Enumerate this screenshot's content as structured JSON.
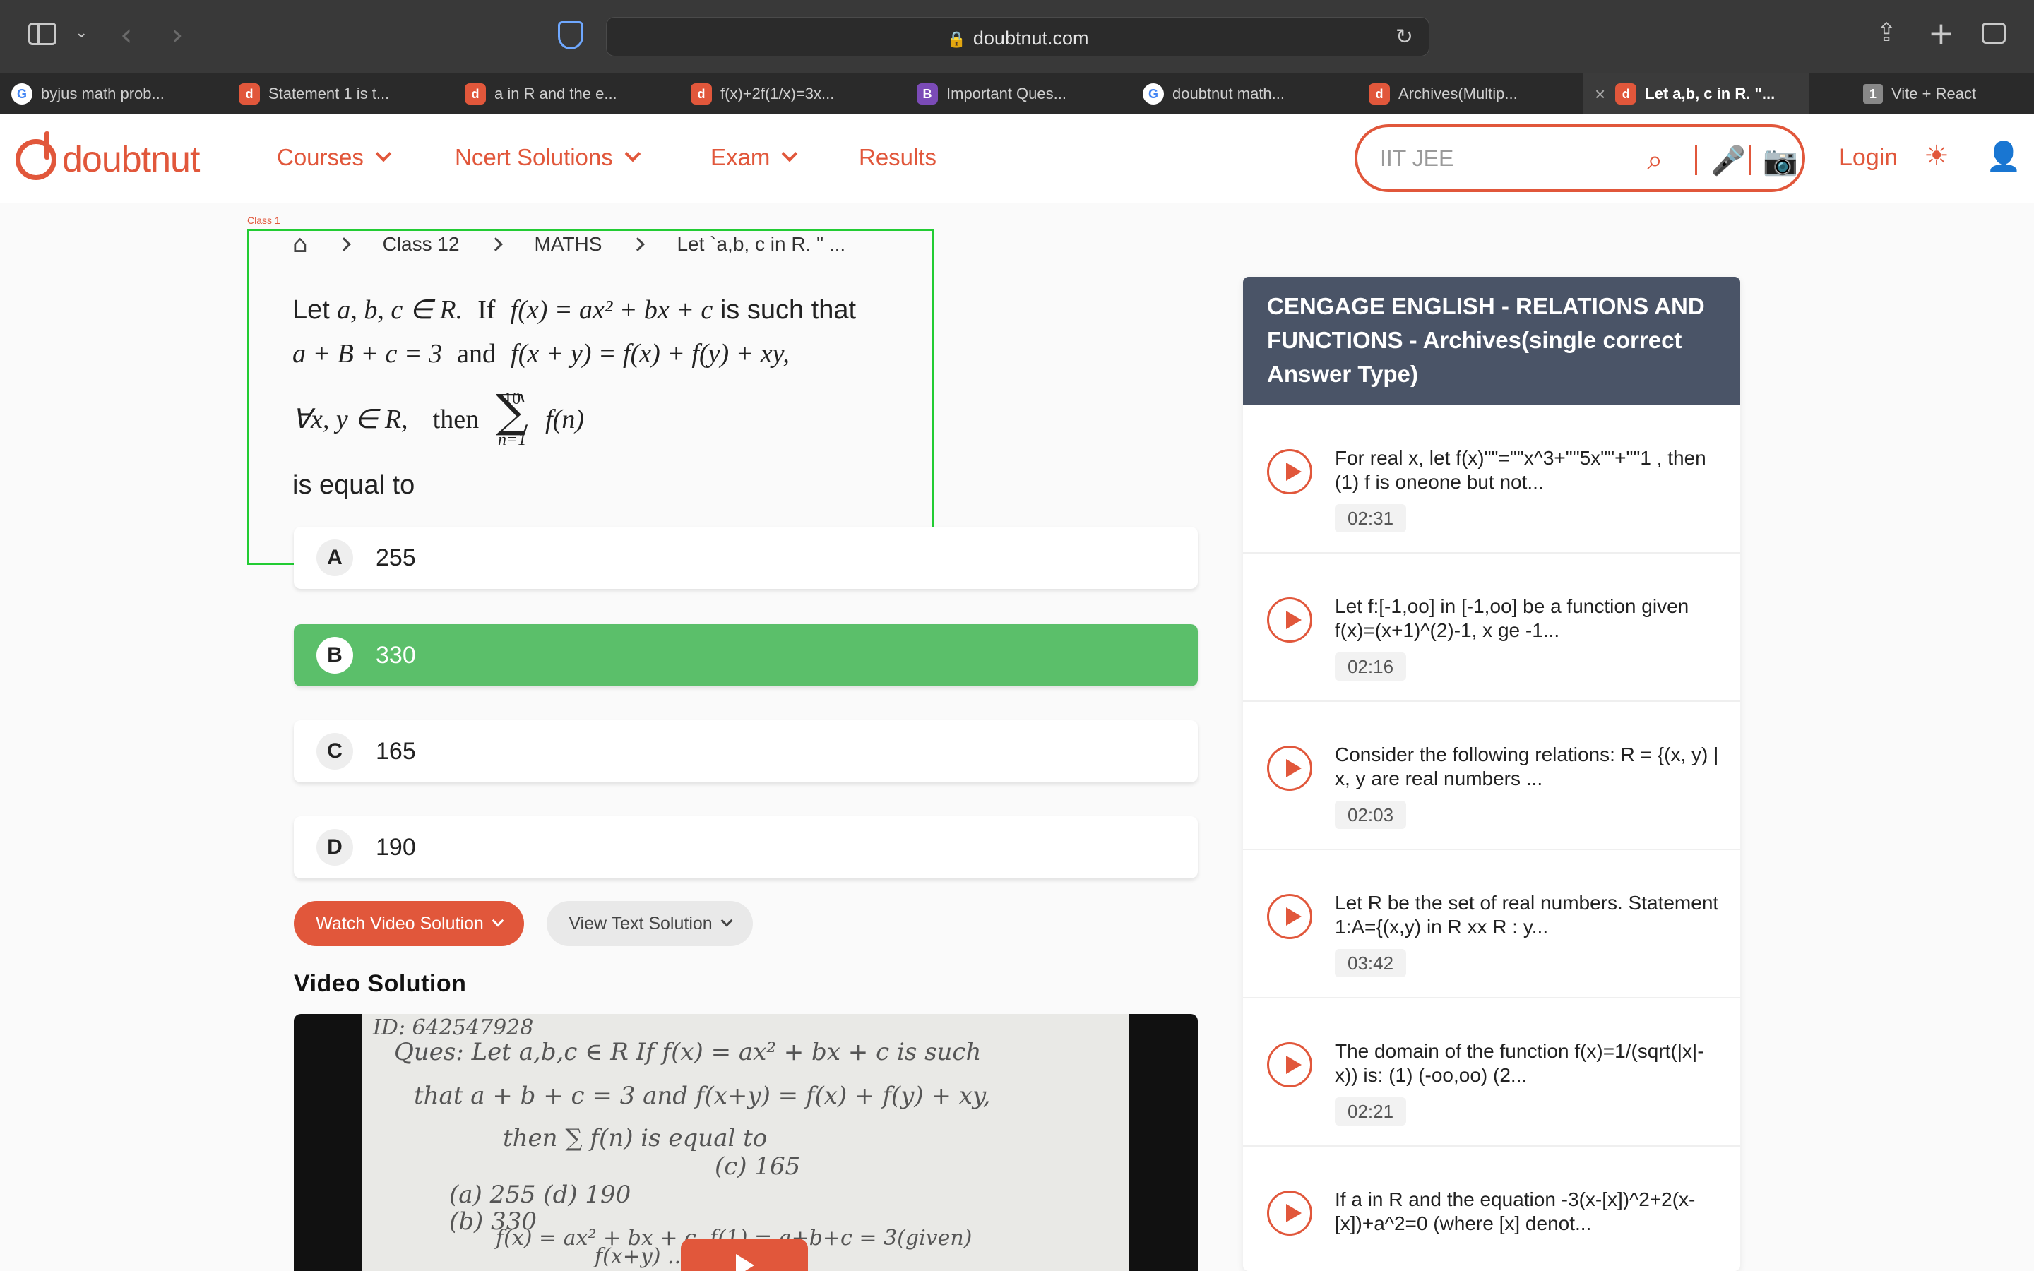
{
  "browser": {
    "url": "doubtnut.com",
    "tabs": [
      {
        "label": "byjus math prob...",
        "favicon": "G",
        "kind": "google"
      },
      {
        "label": "Statement 1 is t...",
        "favicon": "d",
        "kind": "doubtnut"
      },
      {
        "label": "a in R and the e...",
        "favicon": "d",
        "kind": "doubtnut"
      },
      {
        "label": "f(x)+2f(1/x)=3x...",
        "favicon": "d",
        "kind": "doubtnut"
      },
      {
        "label": "Important Ques...",
        "favicon": "B",
        "kind": "byjus"
      },
      {
        "label": "doubtnut math...",
        "favicon": "G",
        "kind": "google"
      },
      {
        "label": "Archives(Multip...",
        "favicon": "d",
        "kind": "doubtnut"
      },
      {
        "label": "Let a,b, c in R. \"...",
        "favicon": "d",
        "kind": "doubtnut",
        "active": true
      },
      {
        "label": "Vite + React",
        "favicon": "1",
        "kind": "number"
      }
    ]
  },
  "site": {
    "logo": "doubtnut",
    "nav": [
      {
        "label": "Courses",
        "has_dropdown": true
      },
      {
        "label": "Ncert Solutions",
        "has_dropdown": true
      },
      {
        "label": "Exam",
        "has_dropdown": true
      },
      {
        "label": "Results",
        "has_dropdown": false
      }
    ],
    "search_placeholder": "IIT JEE",
    "login": "Login",
    "brand_color": "#e1573b"
  },
  "breadcrumb": {
    "tag": "Class 1",
    "items": [
      "Class 12",
      "MATHS",
      "Let `a,b, c in R. \" ..."
    ]
  },
  "question": {
    "line1_a": "Let",
    "line1_math1": "a, b, c ∈ R.",
    "line1_if": "If",
    "line1_math2": "f(x) = ax² + bx + c",
    "line1_b": "is such that",
    "line2_math1": "a + B + c = 3",
    "line2_and": "and",
    "line2_math2": "f(x + y) = f(x) + f(y) + xy,",
    "line3_math1": "∀x, y ∈ R,",
    "line3_then": "then",
    "sum_upper": "10",
    "sum_symbol": "∑",
    "sum_lower": "n=1",
    "line3_math2": "f(n)",
    "line4": "is equal to"
  },
  "options": [
    {
      "letter": "A",
      "text": "255",
      "correct": false
    },
    {
      "letter": "B",
      "text": "330",
      "correct": true
    },
    {
      "letter": "C",
      "text": "165",
      "correct": false
    },
    {
      "letter": "D",
      "text": "190",
      "correct": false
    }
  ],
  "buttons": {
    "watch": "Watch Video Solution",
    "text": "View Text Solution"
  },
  "video": {
    "title": "Video Solution",
    "handwriting": [
      "ID: 642547928",
      "Ques: Let a,b,c ∈ R  If f(x) = ax² + bx + c  is such",
      "that   a + b + c = 3   and   f(x+y) = f(x) + f(y) + xy,",
      "then   ∑ f(n)   is   equal  to",
      "(c)  165",
      "(a)  255          (d)  190",
      "(b)  330",
      "f(x) = ax² + bx + c,    f(1) = a+b+c = 3(given)",
      "f(x+y)  ...  f(y) + xy"
    ]
  },
  "sidebar": {
    "header": "CENGAGE ENGLISH  -  RELATIONS AND FUNCTIONS  -  Archives(single correct Answer Type)",
    "items": [
      {
        "text": "For real x, let f(x)\"\"=\"\"x^3+\"\"5x\"\"+\"\"1 , then (1) f is oneone but not...",
        "duration": "02:31"
      },
      {
        "text": "Let f:[-1,oo] in [-1,oo] be a function given f(x)=(x+1)^(2)-1, x ge -1...",
        "duration": "02:16"
      },
      {
        "text": "Consider the following relations: R = {(x, y) | x, y are real numbers ...",
        "duration": "02:03"
      },
      {
        "text": "Let R be the set of real numbers. Statement 1:A={(x,y) in R xx R : y...",
        "duration": "03:42"
      },
      {
        "text": "The domain of the function f(x)=1/(sqrt(|x|-x)) is: (1) (-oo,oo) (2...",
        "duration": "02:21"
      },
      {
        "text": "If a in R and the equation -3(x-[x])^2+2(x-[x])+a^2=0 (where [x] denot...",
        "duration": ""
      }
    ]
  }
}
